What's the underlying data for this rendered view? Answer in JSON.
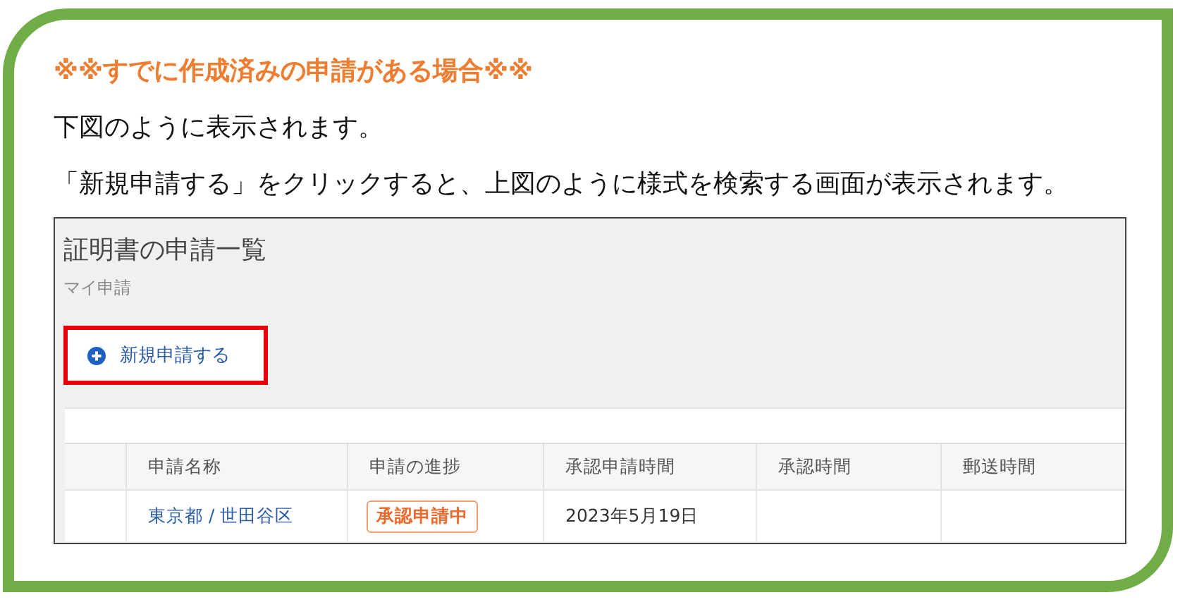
{
  "heading": "※※すでに作成済みの申請がある場合※※",
  "paragraphs": [
    "下図のように表示されます。",
    "「新規申請する」をクリックすると、上図のように様式を検索する画面が表示されます。"
  ],
  "screenshot": {
    "title": "証明書の申請一覧",
    "subtitle": "マイ申請",
    "new_button": {
      "label": "新規申請する",
      "highlighted": true
    },
    "table": {
      "columns": [
        "申請名称",
        "申請の進捗",
        "承認申請時間",
        "承認時間",
        "郵送時間"
      ],
      "rows": [
        {
          "name": "東京都 / 世田谷区",
          "status": "承認申請中",
          "requested_at": "2023年5月19日"
        }
      ]
    }
  }
}
